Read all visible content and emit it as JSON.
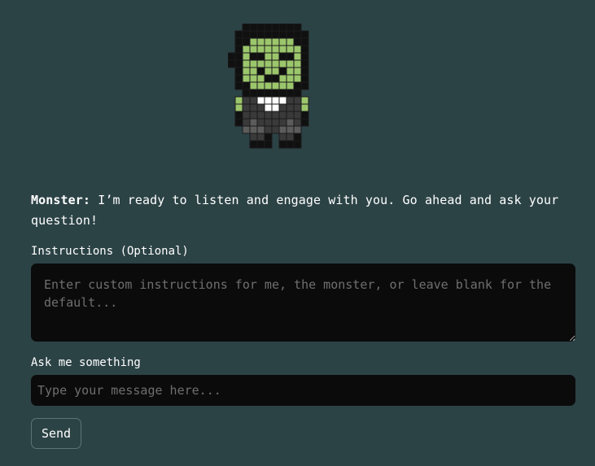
{
  "avatar": {
    "icon": "frankenstein-monster-pixel-icon",
    "colors": {
      "hair": "#101010",
      "skin": "#9cc66c",
      "skin_shade": "#7da955",
      "suit": "#3a3a3a",
      "suit_light": "#5c5c5c",
      "collar": "#ffffff",
      "grid": "#1a1a1a"
    }
  },
  "chat": {
    "speaker": "Monster:",
    "message": "I’m ready to listen and engage with you. Go ahead and ask your question!"
  },
  "instructions": {
    "label": "Instructions (Optional)",
    "placeholder": "Enter custom instructions for me, the monster, or leave blank for the default...",
    "value": ""
  },
  "ask": {
    "label": "Ask me something",
    "placeholder": "Type your message here...",
    "value": ""
  },
  "send_button": {
    "label": "Send"
  },
  "theme": {
    "background": "#2c4346",
    "field_background": "#0b0b0b",
    "placeholder_color": "#6f6f6f"
  }
}
